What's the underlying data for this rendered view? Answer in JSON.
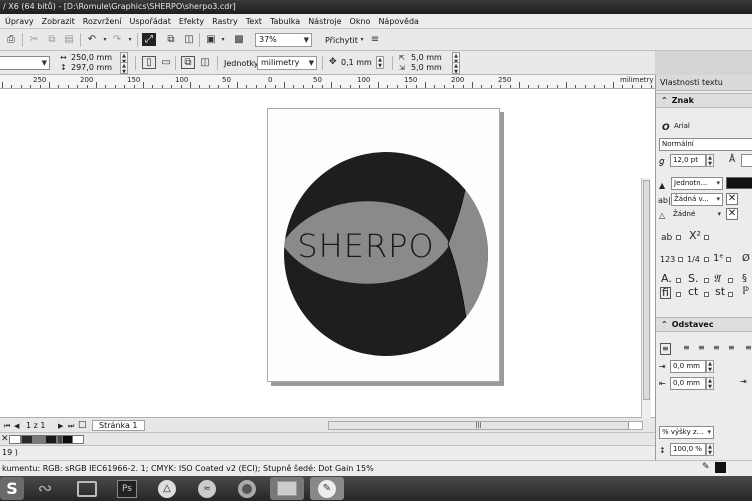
{
  "window": {
    "title": "/ X6 (64 bitů) - [D:\\Romule\\Graphics\\SHERPO\\sherpo3.cdr]"
  },
  "menu": [
    "Úpravy",
    "Zobrazit",
    "Rozvržení",
    "Uspořádat",
    "Efekty",
    "Rastry",
    "Text",
    "Tabulka",
    "Nástroje",
    "Okno",
    "Nápověda"
  ],
  "toolbar": {
    "zoom": "37%",
    "snap_label": "Přichytit"
  },
  "property_bar": {
    "width": "250,0 mm",
    "height": "297,0 mm",
    "units_label": "Jednotky:",
    "units_value": "milimetry",
    "nudge": "0,1 mm",
    "dup_x": "5,0 mm",
    "dup_y": "5,0 mm"
  },
  "ruler": {
    "ticks": [
      "250",
      "200",
      "150",
      "100",
      "50",
      "0",
      "50",
      "100",
      "150",
      "200",
      "250"
    ],
    "unit": "milimetry"
  },
  "logo": {
    "text": "SHERPO",
    "circle_color": "#1e1e1e",
    "fish_color": "#8a8a8a",
    "text_color": "#1a1a1a"
  },
  "page_nav": {
    "counter": "1 z 1",
    "tab": "Stránka 1"
  },
  "palette": {
    "swatches": [
      "#ffffff",
      "#2a2a2a",
      "#7a7a7a",
      "#1a1a1a",
      "#4a4a4a",
      "#0d0d0d",
      "#ffffff"
    ]
  },
  "status": {
    "line1": "19 )",
    "line2": "kumentu: RGB: sRGB IEC61966-2. 1; CMYK: ISO Coated v2 (ECI); Stupně šedé: Dot Gain 15%"
  },
  "docker": {
    "title": "Vlastnosti textu",
    "char_section": "Znak",
    "font": "Arial",
    "style": "Normální",
    "size": "12,0 pt",
    "fill": "Jednotn...",
    "background": "Žádná v...",
    "outline": "Žádné",
    "para_section": "Odstavec",
    "indent1": "0,0 mm",
    "indent2": "0,0 mm",
    "line_spacing_unit": "% výšky z...",
    "line_spacing": "100,0 %"
  },
  "taskbar": {
    "ps_label": "Ps"
  }
}
